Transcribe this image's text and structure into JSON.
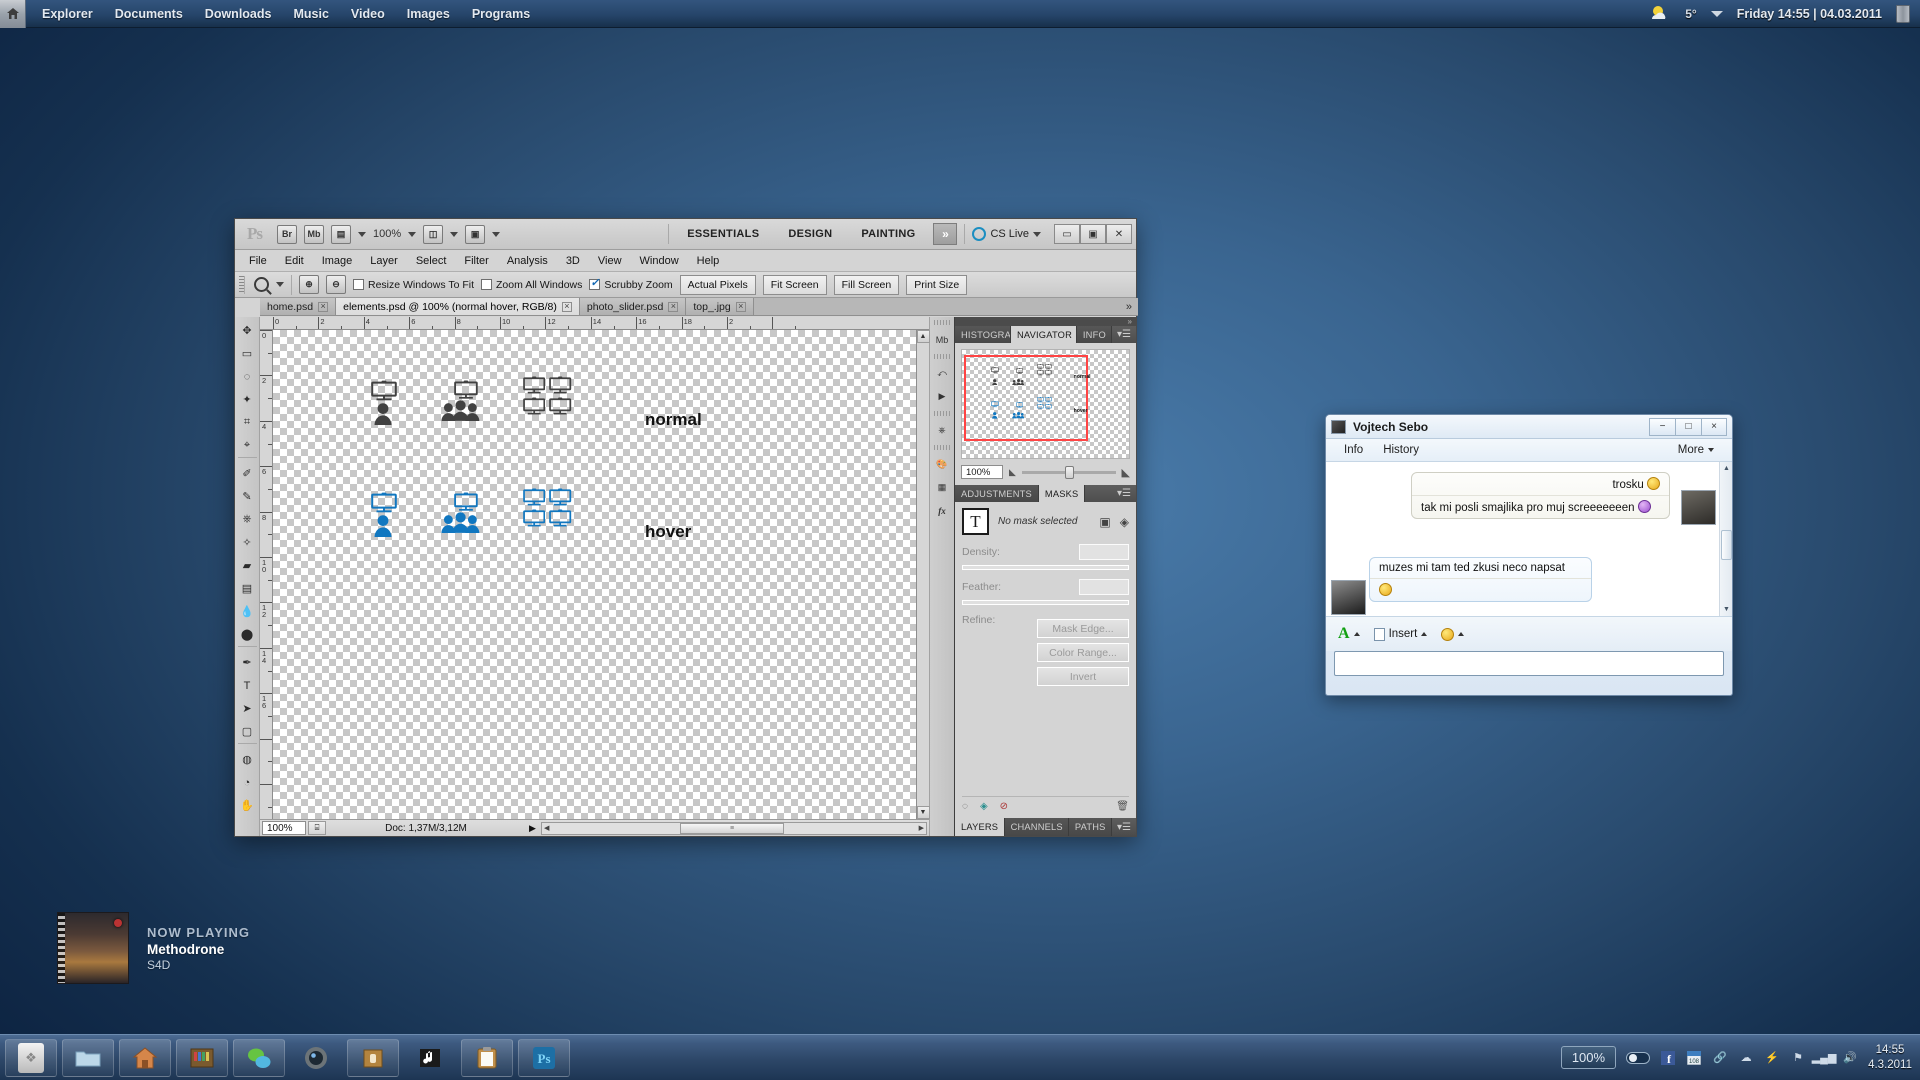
{
  "topbar": {
    "home_icon": "home-icon",
    "menu": [
      "Explorer",
      "Documents",
      "Downloads",
      "Music",
      "Video",
      "Images",
      "Programs"
    ],
    "weather_icon": "sun-cloud-icon",
    "temperature": "5°",
    "dropdown_icon": "chevron-down-icon",
    "clock": "Friday 14:55 | 04.03.2011",
    "trash_icon": "trash-icon"
  },
  "now_playing": {
    "heading": "NOW PLAYING",
    "track": "Methodrone",
    "artist": "S4D",
    "album_art": "album-cover-image"
  },
  "photoshop": {
    "app_logo": "photoshop-ps-logo",
    "appbar": {
      "bridge_label": "Br",
      "minibridge_label": "Mb",
      "view_extras_icon": "view-extras-icon",
      "zoom_level": "100%",
      "arrange_icon": "arrange-documents-icon",
      "screen_mode_icon": "screen-mode-icon",
      "workspaces": [
        "ESSENTIALS",
        "DESIGN",
        "PAINTING"
      ],
      "more_workspaces": "»",
      "cs_live_label": "CS Live",
      "cs_live_icon": "cs-live-icon",
      "window_buttons": [
        "minimize",
        "restore",
        "close"
      ]
    },
    "menubar": [
      "File",
      "Edit",
      "Image",
      "Layer",
      "Select",
      "Filter",
      "Analysis",
      "3D",
      "View",
      "Window",
      "Help"
    ],
    "options_bar": {
      "active_tool_icon": "zoom-tool-icon",
      "zoom_in_icon": "zoom-in-icon",
      "zoom_out_icon": "zoom-out-icon",
      "checkboxes": [
        {
          "label": "Resize Windows To Fit",
          "checked": false
        },
        {
          "label": "Zoom All Windows",
          "checked": false
        },
        {
          "label": "Scrubby Zoom",
          "checked": true
        }
      ],
      "buttons": [
        "Actual Pixels",
        "Fit Screen",
        "Fill Screen",
        "Print Size"
      ]
    },
    "document_tabs": [
      {
        "label": "home.psd",
        "active": false
      },
      {
        "label": "elements.psd @ 100% (normal   hover, RGB/8)",
        "active": true
      },
      {
        "label": "photo_slider.psd",
        "active": false
      },
      {
        "label": "top_.jpg",
        "active": false
      }
    ],
    "tools": [
      "move-tool",
      "rectangular-marquee-tool",
      "lasso-tool",
      "magic-wand-tool",
      "crop-tool",
      "eyedropper-tool",
      "spot-healing-brush-tool",
      "brush-tool",
      "clone-stamp-tool",
      "history-brush-tool",
      "eraser-tool",
      "gradient-tool",
      "blur-tool",
      "dodge-tool",
      "pen-tool",
      "horizontal-type-tool",
      "path-selection-tool",
      "rounded-rectangle-tool",
      "3d-rotate-tool",
      "3d-orbit-tool",
      "hand-tool"
    ],
    "ruler_h_labels": [
      "0",
      "2",
      "4",
      "6",
      "8",
      "10",
      "12",
      "14",
      "16",
      "18",
      "2"
    ],
    "ruler_v_labels": [
      "0",
      "2",
      "4",
      "6",
      "8",
      "10",
      "12",
      "14",
      "16"
    ],
    "canvas": {
      "rows": [
        {
          "label": "normal",
          "color": "#414141"
        },
        {
          "label": "hover",
          "color": "#1177c0"
        }
      ],
      "icon_groups": [
        "single-user-with-monitor",
        "group-of-users-with-monitor",
        "four-monitors-grid"
      ]
    },
    "status_bar": {
      "zoom": "100%",
      "doc_info": "Doc: 1,37M/3,12M",
      "expand_icon": "play-triangle-icon"
    },
    "icon_dock": [
      "mini-bridge-icon",
      "history-icon",
      "actions-icon",
      "clone-source-icon",
      "color-icon",
      "swatches-icon",
      "styles-icon"
    ],
    "panels": {
      "top_group": {
        "tabs": [
          "HISTOGRAM",
          "NAVIGATOR",
          "INFO"
        ],
        "active_tab": "NAVIGATOR",
        "zoom_value": "100%",
        "menu_icon": "panel-menu-icon"
      },
      "mid_group": {
        "tabs": [
          "ADJUSTMENTS",
          "MASKS"
        ],
        "active_tab": "MASKS",
        "thumb_glyph": "T",
        "status_text": "No mask selected",
        "add_pixel_mask_icon": "add-pixel-mask-icon",
        "add_vector_mask_icon": "add-vector-mask-icon",
        "density_label": "Density:",
        "feather_label": "Feather:",
        "refine_label": "Refine:",
        "buttons": [
          "Mask Edge...",
          "Color Range...",
          "Invert"
        ],
        "footer_icons": [
          "load-selection-icon",
          "apply-mask-icon",
          "disable-mask-icon",
          "delete-mask-icon"
        ]
      },
      "bottom_group": {
        "tabs": [
          "LAYERS",
          "CHANNELS",
          "PATHS"
        ],
        "active_tab": "LAYERS"
      }
    }
  },
  "chat": {
    "title": "Vojtech Sebo",
    "contact_avatar": "contact-avatar",
    "window_buttons": [
      "−",
      "□",
      "×"
    ],
    "tabs": [
      "Info",
      "History"
    ],
    "more_label": "More",
    "messages": [
      {
        "from": "them",
        "lines": [
          "trosku",
          "tak mi posli smajlika pro muj screeeeeeen"
        ],
        "emoticons": [
          "wink-smiley",
          "devil-smiley"
        ],
        "avatar": "them-avatar"
      },
      {
        "from": "me",
        "lines": [
          "muzes mi tam ted zkusi neco napsat",
          ""
        ],
        "emoticons": [
          "happy-smiley"
        ],
        "avatar": "me-avatar"
      }
    ],
    "compose": {
      "font_button": "A",
      "insert_label": "Insert",
      "insert_icon": "insert-file-icon",
      "emoticon_icon": "emoticon-icon",
      "input_placeholder": ""
    }
  },
  "taskbar": {
    "items": [
      "start-orb",
      "file-manager-icon",
      "home-folder-icon",
      "bookshelf-icon",
      "chat-bubbles-icon",
      "camera-lens-icon",
      "package-box-icon",
      "music-note-icon",
      "clipboard-icon",
      "photoshop-icon"
    ],
    "tray": {
      "zoom": "100%",
      "toggle": "sound-toggle",
      "icons": [
        "facebook-icon",
        "calendar-108-icon",
        "link-icon",
        "cloud-icon",
        "plug-icon",
        "flag-icon",
        "signal-bars-icon",
        "volume-icon"
      ],
      "time": "14:55",
      "date": "4.3.2011"
    }
  }
}
